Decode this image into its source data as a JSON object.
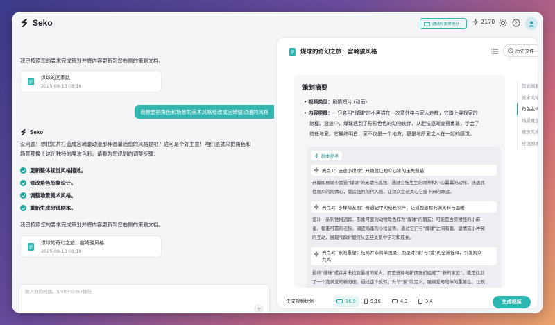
{
  "app": {
    "name": "Seko"
  },
  "topbar": {
    "invite_label": "邀请好友得积分",
    "points": "2170"
  },
  "chat": {
    "msg1": "我已按照您的要求完成策划并将内容更新到您右侧的策划文档。",
    "card1": {
      "title": "煤球的回家路",
      "date": "2025-08-13 08:16"
    },
    "user_msg": "我想要把角色和场景的美术风格修改成宫崎骏动漫的风格",
    "bot_name": "Seko",
    "reply_line1": "没问题！想把短片打造成宫崎骏动漫那种温馨治愈的风格是吧？这可是个好主意！咱们这就来把角色和",
    "reply_line2": "场景都换上这份独特的魔法色彩。请看为您规划的调整步骤：",
    "steps": [
      "更新整体视觉风格描述。",
      "修改角色形象设计。",
      "调整场景美术风格。",
      "重新生成分镜剧本。"
    ],
    "msg2": "我已按照您的要求完成策划并将内容更新到您右侧的策划文档。",
    "card2": {
      "title": "煤球的奇幻之旅：宫崎骏风格",
      "date": "2025-08-13 08:18"
    },
    "input_placeholder": "输入你的问题。Shift+Enter换行"
  },
  "doc": {
    "title": "煤球的奇幻之旅：宫崎骏风格",
    "history_label": "历史文件",
    "section_title": "策划摘要",
    "video_type_label": "视频类型：",
    "video_type_value": "剧情短片 (动画)",
    "synopsis_label": "内容梗概：",
    "synopsis_line1": "一只名叫\"煤球\"的小黑猫在一次意外中与家人走散，它踏上寻找家的",
    "synopsis_line2": "旅程。沿途中，煤球遇到了形形色色的动物伙伴，从胆怯逐渐变得勇敢，学会了",
    "synopsis_line3": "信任与爱。它最终明白，家不仅是一个地方，更是与所爱之人在一起的感觉。",
    "highlights_tag": "剧本亮点",
    "highlights": [
      {
        "head": "亮点1：迷途小煤球：开篇就让观众心疼的走失萌猫",
        "body1": "开篇即展现小黑猫\"煤球\"的无助与孤独，通过它怯生生的眼神和小心翼翼的动作，快速抓",
        "body2": "住观众的同情心，营造强烈的代入感，让观众立刻关心它接下来的命运。"
      },
      {
        "head": "亮点2：多样萌友图：奇遇记中的成长伙伴，让孤独旅程充满笑料与温暖",
        "body1": "设计一系列性格迥异、形象可爱的动物角色作为\"煤球\"的朋友：可能是古灵精怪的小麻",
        "body2": "雀、稳重可靠的老狗、调皮捣蛋的小松鼠等。通过它们与\"煤球\"之间有趣、温情或小冲突",
        "body3": "的互动，展现\"煤球\"如何从这些关系中学习和成长。"
      },
      {
        "head": "亮点3：家的重塑：结局并非简单团聚，而是对\"家\"与\"爱\"的全新诠释，引发观众",
        "head2": "共鸣",
        "body1": "最终\"煤球\"或许并未找到最初的家人，而是选择与新朋友们组成了\"新的家庭\"，或是找到",
        "body2": "了一个充满爱的新归宿。通过这个反转，升华\"家\"的定义，强调爱与陪伴的重要性，让观"
      }
    ],
    "toc": [
      "策划摘要",
      "美术风格",
      "角色主体",
      "场景概念",
      "音乐风格",
      "分镜剧本"
    ],
    "toc_active": 2,
    "ratio_label": "生成视频比例",
    "ratios": [
      "16:9",
      "9:16",
      "4:3",
      "3:4"
    ],
    "ratio_active": 0,
    "generate_label": "生成视频"
  },
  "colors": {
    "accent": "#2cb7b0",
    "accent_dark": "#1ea89f"
  }
}
